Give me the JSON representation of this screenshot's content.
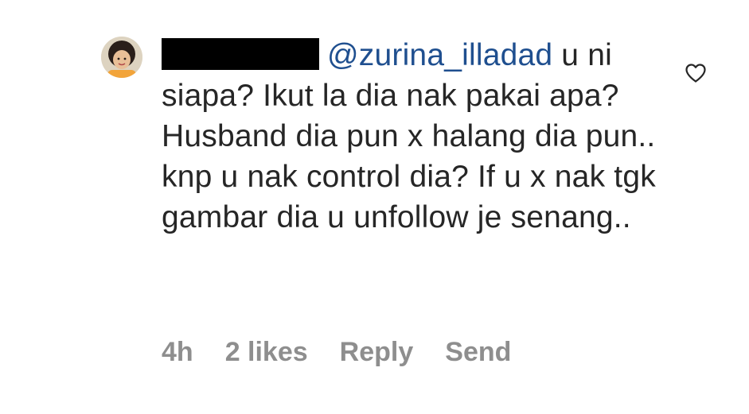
{
  "comment": {
    "avatar": "user-avatar-photo",
    "username_redacted": true,
    "mention": "@zurina_illadad",
    "text": " u ni siapa? Ikut la dia nak pakai apa? Husband dia pun x halang dia pun.. knp u nak control dia? If u x nak tgk gambar dia u unfollow je senang..",
    "like_icon": "heart-outline-icon",
    "meta": {
      "time": "4h",
      "likes": "2 likes",
      "reply_label": "Reply",
      "send_label": "Send"
    }
  },
  "colors": {
    "text": "#262626",
    "mention": "#1f4f8f",
    "meta": "#8e8e8e",
    "background": "#ffffff"
  }
}
